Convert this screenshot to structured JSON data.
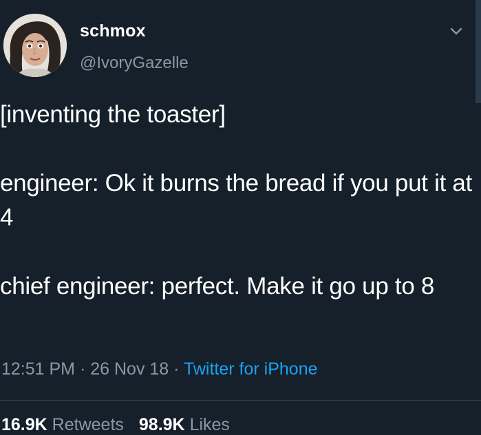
{
  "user": {
    "display_name": "schmox",
    "handle": "@IvoryGazelle"
  },
  "tweet": {
    "paragraphs": [
      "[inventing the toaster]",
      "engineer: Ok it burns the bread if you put it at 4",
      "chief engineer: perfect. Make it go up to 8"
    ],
    "time": "12:51 PM",
    "date": "26 Nov 18",
    "separator": " · ",
    "source": "Twitter for iPhone"
  },
  "stats": {
    "retweets_count": "16.9K",
    "retweets_label": "Retweets",
    "likes_count": "98.9K",
    "likes_label": "Likes"
  },
  "colors": {
    "background": "#15202b",
    "muted_text": "#8899a6",
    "link": "#1da1f2"
  },
  "icons": {
    "menu": "chevron-down-icon"
  }
}
